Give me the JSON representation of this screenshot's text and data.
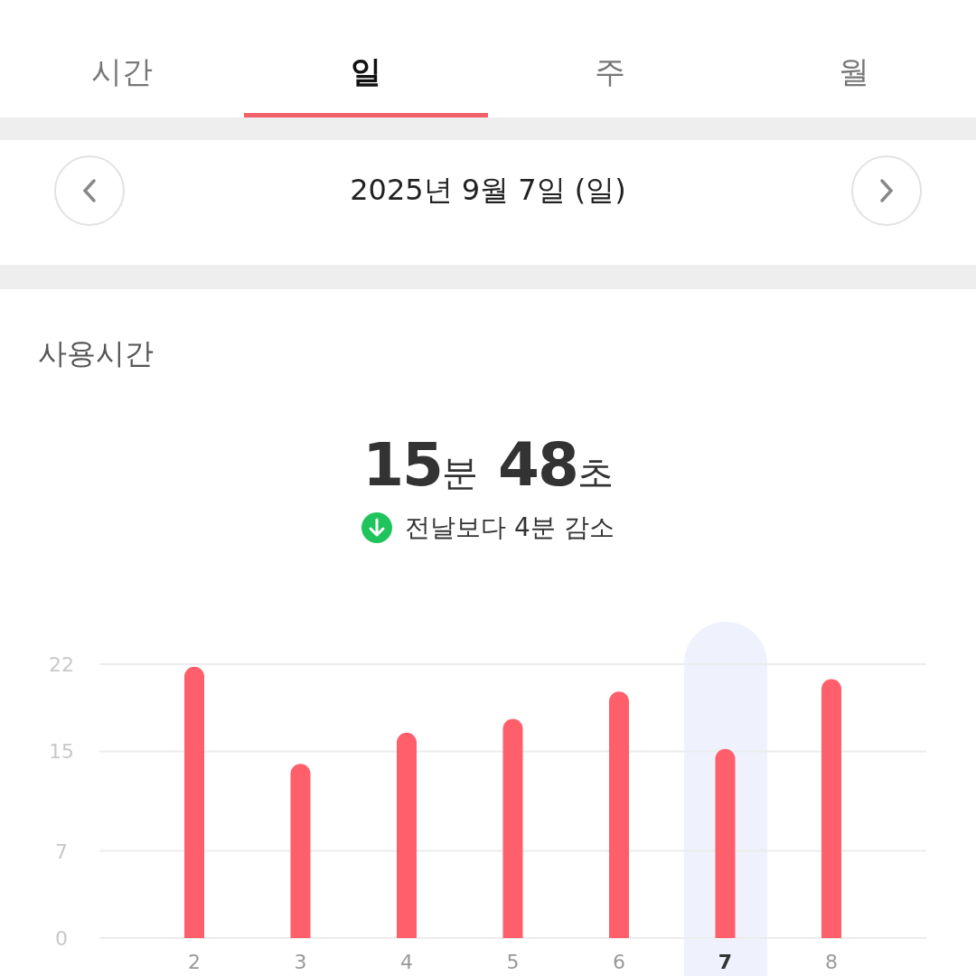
{
  "tabs": [
    {
      "label": "시간",
      "selected": false
    },
    {
      "label": "일",
      "selected": true
    },
    {
      "label": "주",
      "selected": false
    },
    {
      "label": "월",
      "selected": false
    }
  ],
  "date_nav": {
    "date": "2025년 9월 7일 (일)"
  },
  "usage": {
    "title": "사용시간",
    "minutes": "15",
    "minutes_unit": "분",
    "seconds": "48",
    "seconds_unit": "초",
    "comparison": {
      "kind": "decrease",
      "text": "전날보다 4분 감소"
    },
    "day_states": [
      {
        "selected": false
      },
      {
        "selected": false
      },
      {
        "selected": false
      },
      {
        "selected": false
      },
      {
        "selected": false
      },
      {
        "selected": true
      },
      {
        "selected": false
      }
    ],
    "chart_data": {
      "type": "bar",
      "categories": [
        "2",
        "3",
        "4",
        "5",
        "6",
        "7",
        "8"
      ],
      "series": [
        {
          "color": "#ff5f6b",
          "values": [
            21.8,
            14.0,
            16.5,
            17.6,
            19.8,
            15.2,
            20.8
          ]
        }
      ],
      "ylim": [
        0,
        22
      ],
      "yticks": [
        0,
        7,
        15,
        22
      ]
    }
  }
}
